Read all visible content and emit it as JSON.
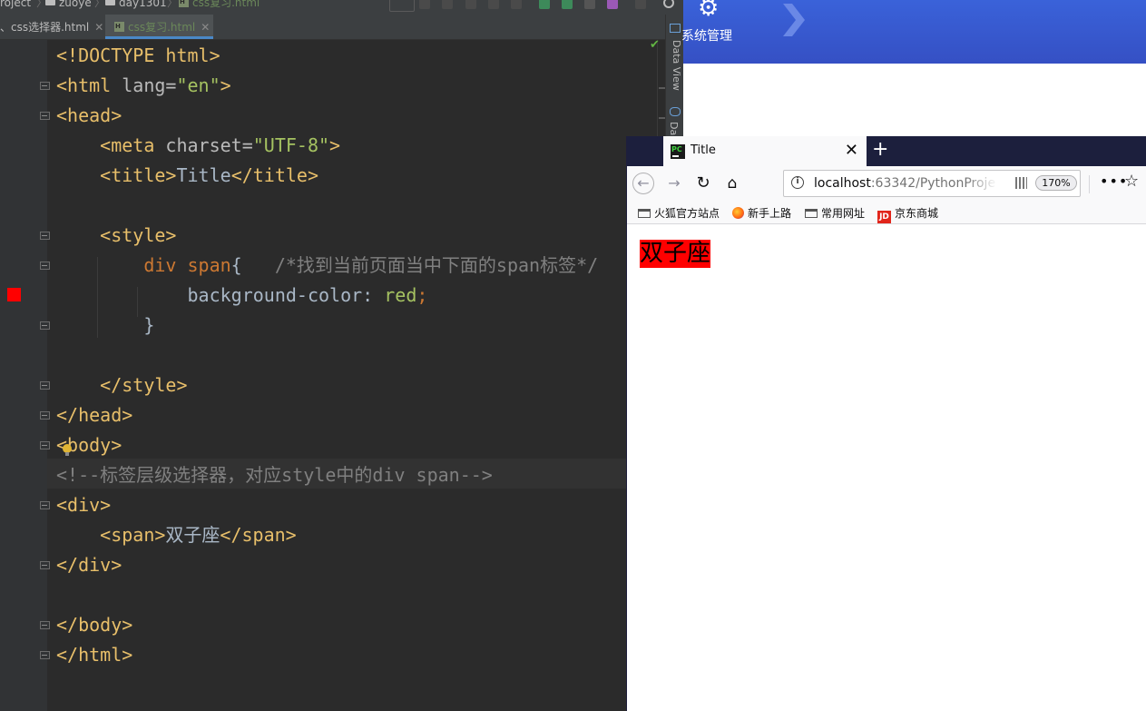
{
  "ide": {
    "breadcrumbs": [
      "roject",
      "zuoye",
      "day1301",
      "css复习.html"
    ],
    "tabs": [
      {
        "label": "、css选择器.html",
        "active": false
      },
      {
        "label": "css复习.html",
        "active": true
      }
    ],
    "code_lines": [
      [
        {
          "t": "tag",
          "v": "<!DOCTYPE html>"
        }
      ],
      [
        {
          "t": "tag",
          "v": "<html "
        },
        {
          "t": "attr",
          "v": "lang="
        },
        {
          "t": "str",
          "v": "\"en\""
        },
        {
          "t": "tag",
          "v": ">"
        }
      ],
      [
        {
          "t": "tag",
          "v": "<head>"
        }
      ],
      [
        {
          "t": "plain",
          "v": "    "
        },
        {
          "t": "tag",
          "v": "<meta "
        },
        {
          "t": "attr",
          "v": "charset="
        },
        {
          "t": "str",
          "v": "\"UTF-8\""
        },
        {
          "t": "tag",
          "v": ">"
        }
      ],
      [
        {
          "t": "plain",
          "v": "    "
        },
        {
          "t": "tag",
          "v": "<title>"
        },
        {
          "t": "plain",
          "v": "Title"
        },
        {
          "t": "tag",
          "v": "</title>"
        }
      ],
      [],
      [
        {
          "t": "plain",
          "v": "    "
        },
        {
          "t": "tag",
          "v": "<style>"
        }
      ],
      [
        {
          "t": "plain",
          "v": "        "
        },
        {
          "t": "sel",
          "v": "div span"
        },
        {
          "t": "plain",
          "v": "{   "
        },
        {
          "t": "cmt",
          "v": "/*找到当前页面当中下面的span标签*/"
        }
      ],
      [
        {
          "t": "plain",
          "v": "            background-color: "
        },
        {
          "t": "str",
          "v": "red"
        },
        {
          "t": "sel",
          "v": ";"
        }
      ],
      [
        {
          "t": "plain",
          "v": "        }"
        }
      ],
      [],
      [
        {
          "t": "plain",
          "v": "    "
        },
        {
          "t": "tag",
          "v": "</style>"
        }
      ],
      [
        {
          "t": "tag",
          "v": "</head>"
        }
      ],
      [
        {
          "t": "tag",
          "v": "<body>"
        }
      ],
      [
        {
          "t": "cmt",
          "v": "<!--标签层级选择器，对应style中的div span-->"
        }
      ],
      [
        {
          "t": "tag",
          "v": "<div>"
        }
      ],
      [
        {
          "t": "plain",
          "v": "    "
        },
        {
          "t": "tag",
          "v": "<span>"
        },
        {
          "t": "plain",
          "v": "双子座"
        },
        {
          "t": "tag",
          "v": "</span>"
        }
      ],
      [
        {
          "t": "tag",
          "v": "</div>"
        }
      ],
      [],
      [
        {
          "t": "tag",
          "v": "</body>"
        }
      ],
      [
        {
          "t": "tag",
          "v": "</html>"
        }
      ]
    ],
    "side_panel_labels": [
      "Data View",
      "Da"
    ]
  },
  "background_app": {
    "menu_label": "系统管理"
  },
  "browser": {
    "tab_title": "Title",
    "favicon_text": "PC",
    "url_host": "localhost",
    "url_rest": ":63342/PythonProje",
    "zoom": "170%",
    "bookmarks": [
      "火狐官方站点",
      "新手上路",
      "常用网址",
      "京东商城"
    ],
    "jd_icon_text": "JD",
    "page_text": "双子座"
  },
  "colors": {
    "editor_bg": "#2b2b2b",
    "tag": "#e8bf6a",
    "string": "#a5c261",
    "selector": "#cc7832",
    "comment": "#808080",
    "span_bg": "#ff0000"
  }
}
